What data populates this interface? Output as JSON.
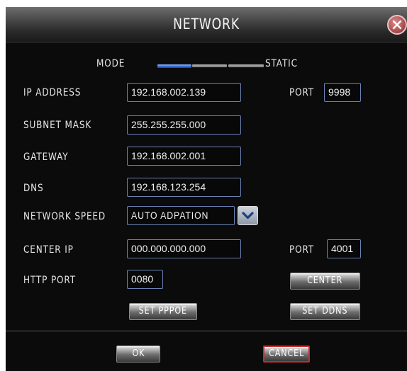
{
  "window": {
    "title": "NETWORK"
  },
  "mode": {
    "label": "MODE",
    "value": "STATIC",
    "selected_index": 0,
    "segments": 3
  },
  "fields": {
    "ip_address": {
      "label": "IP ADDRESS",
      "value": "192.168.002.139"
    },
    "ip_port": {
      "label": "PORT",
      "value": "9998"
    },
    "subnet_mask": {
      "label": "SUBNET MASK",
      "value": "255.255.255.000"
    },
    "gateway": {
      "label": "GATEWAY",
      "value": "192.168.002.001"
    },
    "dns": {
      "label": "DNS",
      "value": "192.168.123.254"
    },
    "network_speed": {
      "label": "NETWORK SPEED",
      "value": "AUTO ADPATION"
    },
    "center_ip": {
      "label": "CENTER IP",
      "value": "000.000.000.000"
    },
    "center_port": {
      "label": "PORT",
      "value": "4001"
    },
    "http_port": {
      "label": "HTTP PORT",
      "value": "0080"
    }
  },
  "buttons": {
    "center": "CENTER",
    "set_pppoe": "SET PPPOE",
    "set_ddns": "SET DDNS",
    "ok": "OK",
    "cancel": "CANCEL"
  },
  "icons": {
    "close": "close-icon",
    "dropdown": "chevron-down-icon"
  },
  "colors": {
    "background": "#0b0b0b",
    "field_border": "#6b82b5",
    "mode_active": "#2d6be3",
    "cancel_border": "#cc2a2a",
    "close_button": "#b35454"
  }
}
